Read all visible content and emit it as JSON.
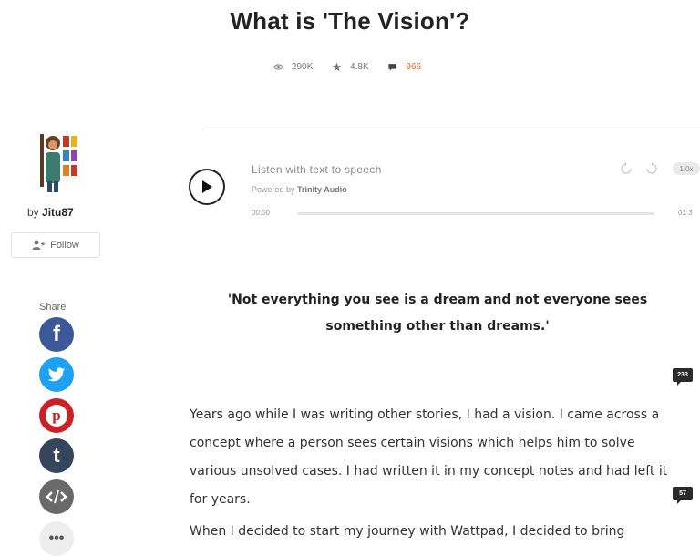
{
  "story": {
    "title": "What is 'The Vision'?",
    "stats": {
      "reads": "290K",
      "votes": "4.8K",
      "comments": "966"
    }
  },
  "author": {
    "by": "by",
    "name": "Jitu87",
    "follow_label": "Follow"
  },
  "share": {
    "label": "Share",
    "more": "•••"
  },
  "player": {
    "title": "Listen with text to speech",
    "powered_prefix": "Powered by",
    "powered_brand": "Trinity Audio",
    "time_start": "00:00",
    "time_end": "01:3",
    "speed": "1.0x"
  },
  "content": {
    "quote_line1": "'Not everything you see is a dream and not everyone sees",
    "quote_line2": "something other than dreams.'",
    "paragraph1_comments": "233",
    "paragraph1": "Years ago while I was writing other stories, I had a vision. I came across a concept where a person sees certain visions which helps him to solve various unsolved cases. I had written it in my concept notes and had left it for years.",
    "paragraph2_comments": "57",
    "paragraph2": "When I decided to start my journey with Wattpad, I decided to bring"
  },
  "colors": {
    "comments_accent": "#ff6122",
    "facebook": "#3b5998",
    "twitter": "#1da1f2",
    "pinterest": "#cb2027",
    "tumblr": "#35465c"
  },
  "icons": [
    "eye-icon",
    "star-icon",
    "comment-icon",
    "follow-user-icon",
    "facebook-icon",
    "twitter-icon",
    "pinterest-icon",
    "tumblr-icon",
    "embed-icon",
    "more-icon",
    "play-icon",
    "rewind-icon",
    "forward-icon"
  ]
}
